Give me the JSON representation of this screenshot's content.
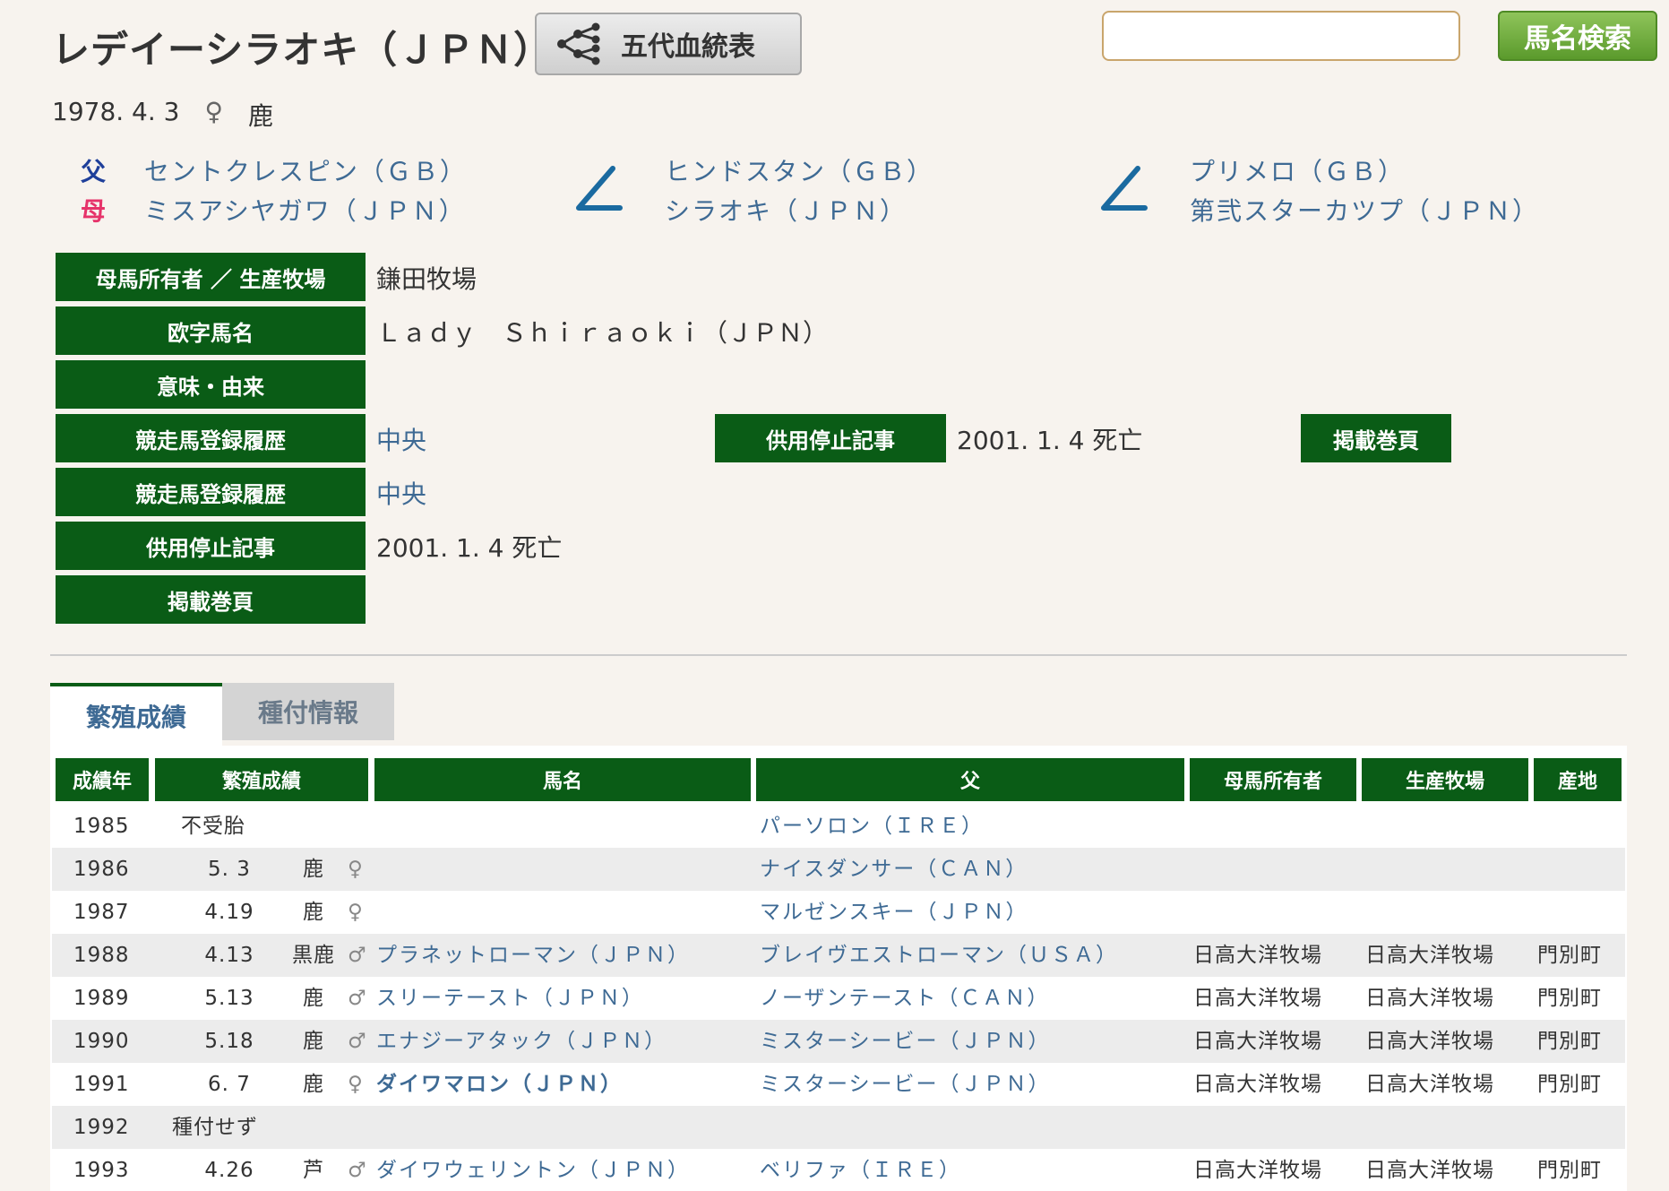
{
  "header": {
    "horse_name": "レデイーシラオキ（ＪＰＮ）",
    "pedigree_button": "五代血統表",
    "search_placeholder": "",
    "search_button": "馬名検索"
  },
  "birth": {
    "date": "1978. 4. 3",
    "sex": "♀",
    "coat": "鹿"
  },
  "parents": {
    "father_label": "父",
    "mother_label": "母",
    "father": "セントクレスピン（ＧＢ）",
    "mother": "ミスアシヤガワ（ＪＰＮ）",
    "dam_sire": "ヒンドスタン（ＧＢ）",
    "dam_dam": "シラオキ（ＪＰＮ）",
    "ddam_sire": "プリメロ（ＧＢ）",
    "ddam_dam": "第弐スターカツプ（ＪＰＮ）"
  },
  "info": {
    "owner_label": "母馬所有者 ／ 生産牧場",
    "owner_value": "鎌田牧場",
    "roman_label": "欧字馬名",
    "roman_value": "Ｌａｄｙ　Ｓｈｉｒａｏｋｉ（ＪＰＮ）",
    "meaning_label": "意味・由来",
    "meaning_value": "",
    "reg_label_1": "競走馬登録履歴",
    "reg_value_1": "中央",
    "stop_label_mid": "供用停止記事",
    "stop_value_mid": "2001. 1. 4 死亡",
    "page_label_right": "掲載巻頁",
    "reg_label_2": "競走馬登録履歴",
    "reg_value_2": "中央",
    "stop_label": "供用停止記事",
    "stop_value": "2001. 1. 4 死亡",
    "page_label": "掲載巻頁"
  },
  "tabs": [
    {
      "label": "繁殖成績",
      "active": true
    },
    {
      "label": "種付情報",
      "active": false
    }
  ],
  "table": {
    "headers": [
      "成績年",
      "繁殖成績",
      "馬名",
      "父",
      "母馬所有者",
      "生産牧場",
      "産地"
    ],
    "rows": [
      {
        "year": "1985",
        "result": "不受胎",
        "coat": "",
        "sex": "",
        "name": "",
        "sire": "パーソロン（ＩＲＥ）",
        "owner": "",
        "breeder": "",
        "place": ""
      },
      {
        "year": "1986",
        "result": "5. 3",
        "coat": "鹿",
        "sex": "♀",
        "name": "",
        "sire": "ナイスダンサー（ＣＡＮ）",
        "owner": "",
        "breeder": "",
        "place": ""
      },
      {
        "year": "1987",
        "result": "4.19",
        "coat": "鹿",
        "sex": "♀",
        "name": "",
        "sire": "マルゼンスキー（ＪＰＮ）",
        "owner": "",
        "breeder": "",
        "place": ""
      },
      {
        "year": "1988",
        "result": "4.13",
        "coat": "黒鹿",
        "sex": "♂",
        "name": "プラネットローマン（ＪＰＮ）",
        "sire": "ブレイヴエストローマン（ＵＳＡ）",
        "owner": "日高大洋牧場",
        "breeder": "日高大洋牧場",
        "place": "門別町"
      },
      {
        "year": "1989",
        "result": "5.13",
        "coat": "鹿",
        "sex": "♂",
        "name": "スリーテースト（ＪＰＮ）",
        "sire": "ノーザンテースト（ＣＡＮ）",
        "owner": "日高大洋牧場",
        "breeder": "日高大洋牧場",
        "place": "門別町"
      },
      {
        "year": "1990",
        "result": "5.18",
        "coat": "鹿",
        "sex": "♂",
        "name": "エナジーアタック（ＪＰＮ）",
        "sire": "ミスターシービー（ＪＰＮ）",
        "owner": "日高大洋牧場",
        "breeder": "日高大洋牧場",
        "place": "門別町"
      },
      {
        "year": "1991",
        "result": "6. 7",
        "coat": "鹿",
        "sex": "♀",
        "name": "ダイワマロン（ＪＰＮ）",
        "sire": "ミスターシービー（ＪＰＮ）",
        "owner": "日高大洋牧場",
        "breeder": "日高大洋牧場",
        "place": "門別町"
      },
      {
        "year": "1992",
        "result": "種付せず",
        "coat": "",
        "sex": "",
        "name": "",
        "sire": "",
        "owner": "",
        "breeder": "",
        "place": ""
      },
      {
        "year": "1993",
        "result": "4.26",
        "coat": "芦",
        "sex": "♂",
        "name": "ダイワウェリントン（ＪＰＮ）",
        "sire": "ベリファ（ＩＲＥ）",
        "owner": "日高大洋牧場",
        "breeder": "日高大洋牧場",
        "place": "門別町"
      }
    ]
  },
  "colors": {
    "label_green": "#0a5c16",
    "link_blue": "#3e6a94",
    "father_blue": "#1e3f9a",
    "mother_pink": "#e6336a",
    "background": "#f7f3ee"
  }
}
